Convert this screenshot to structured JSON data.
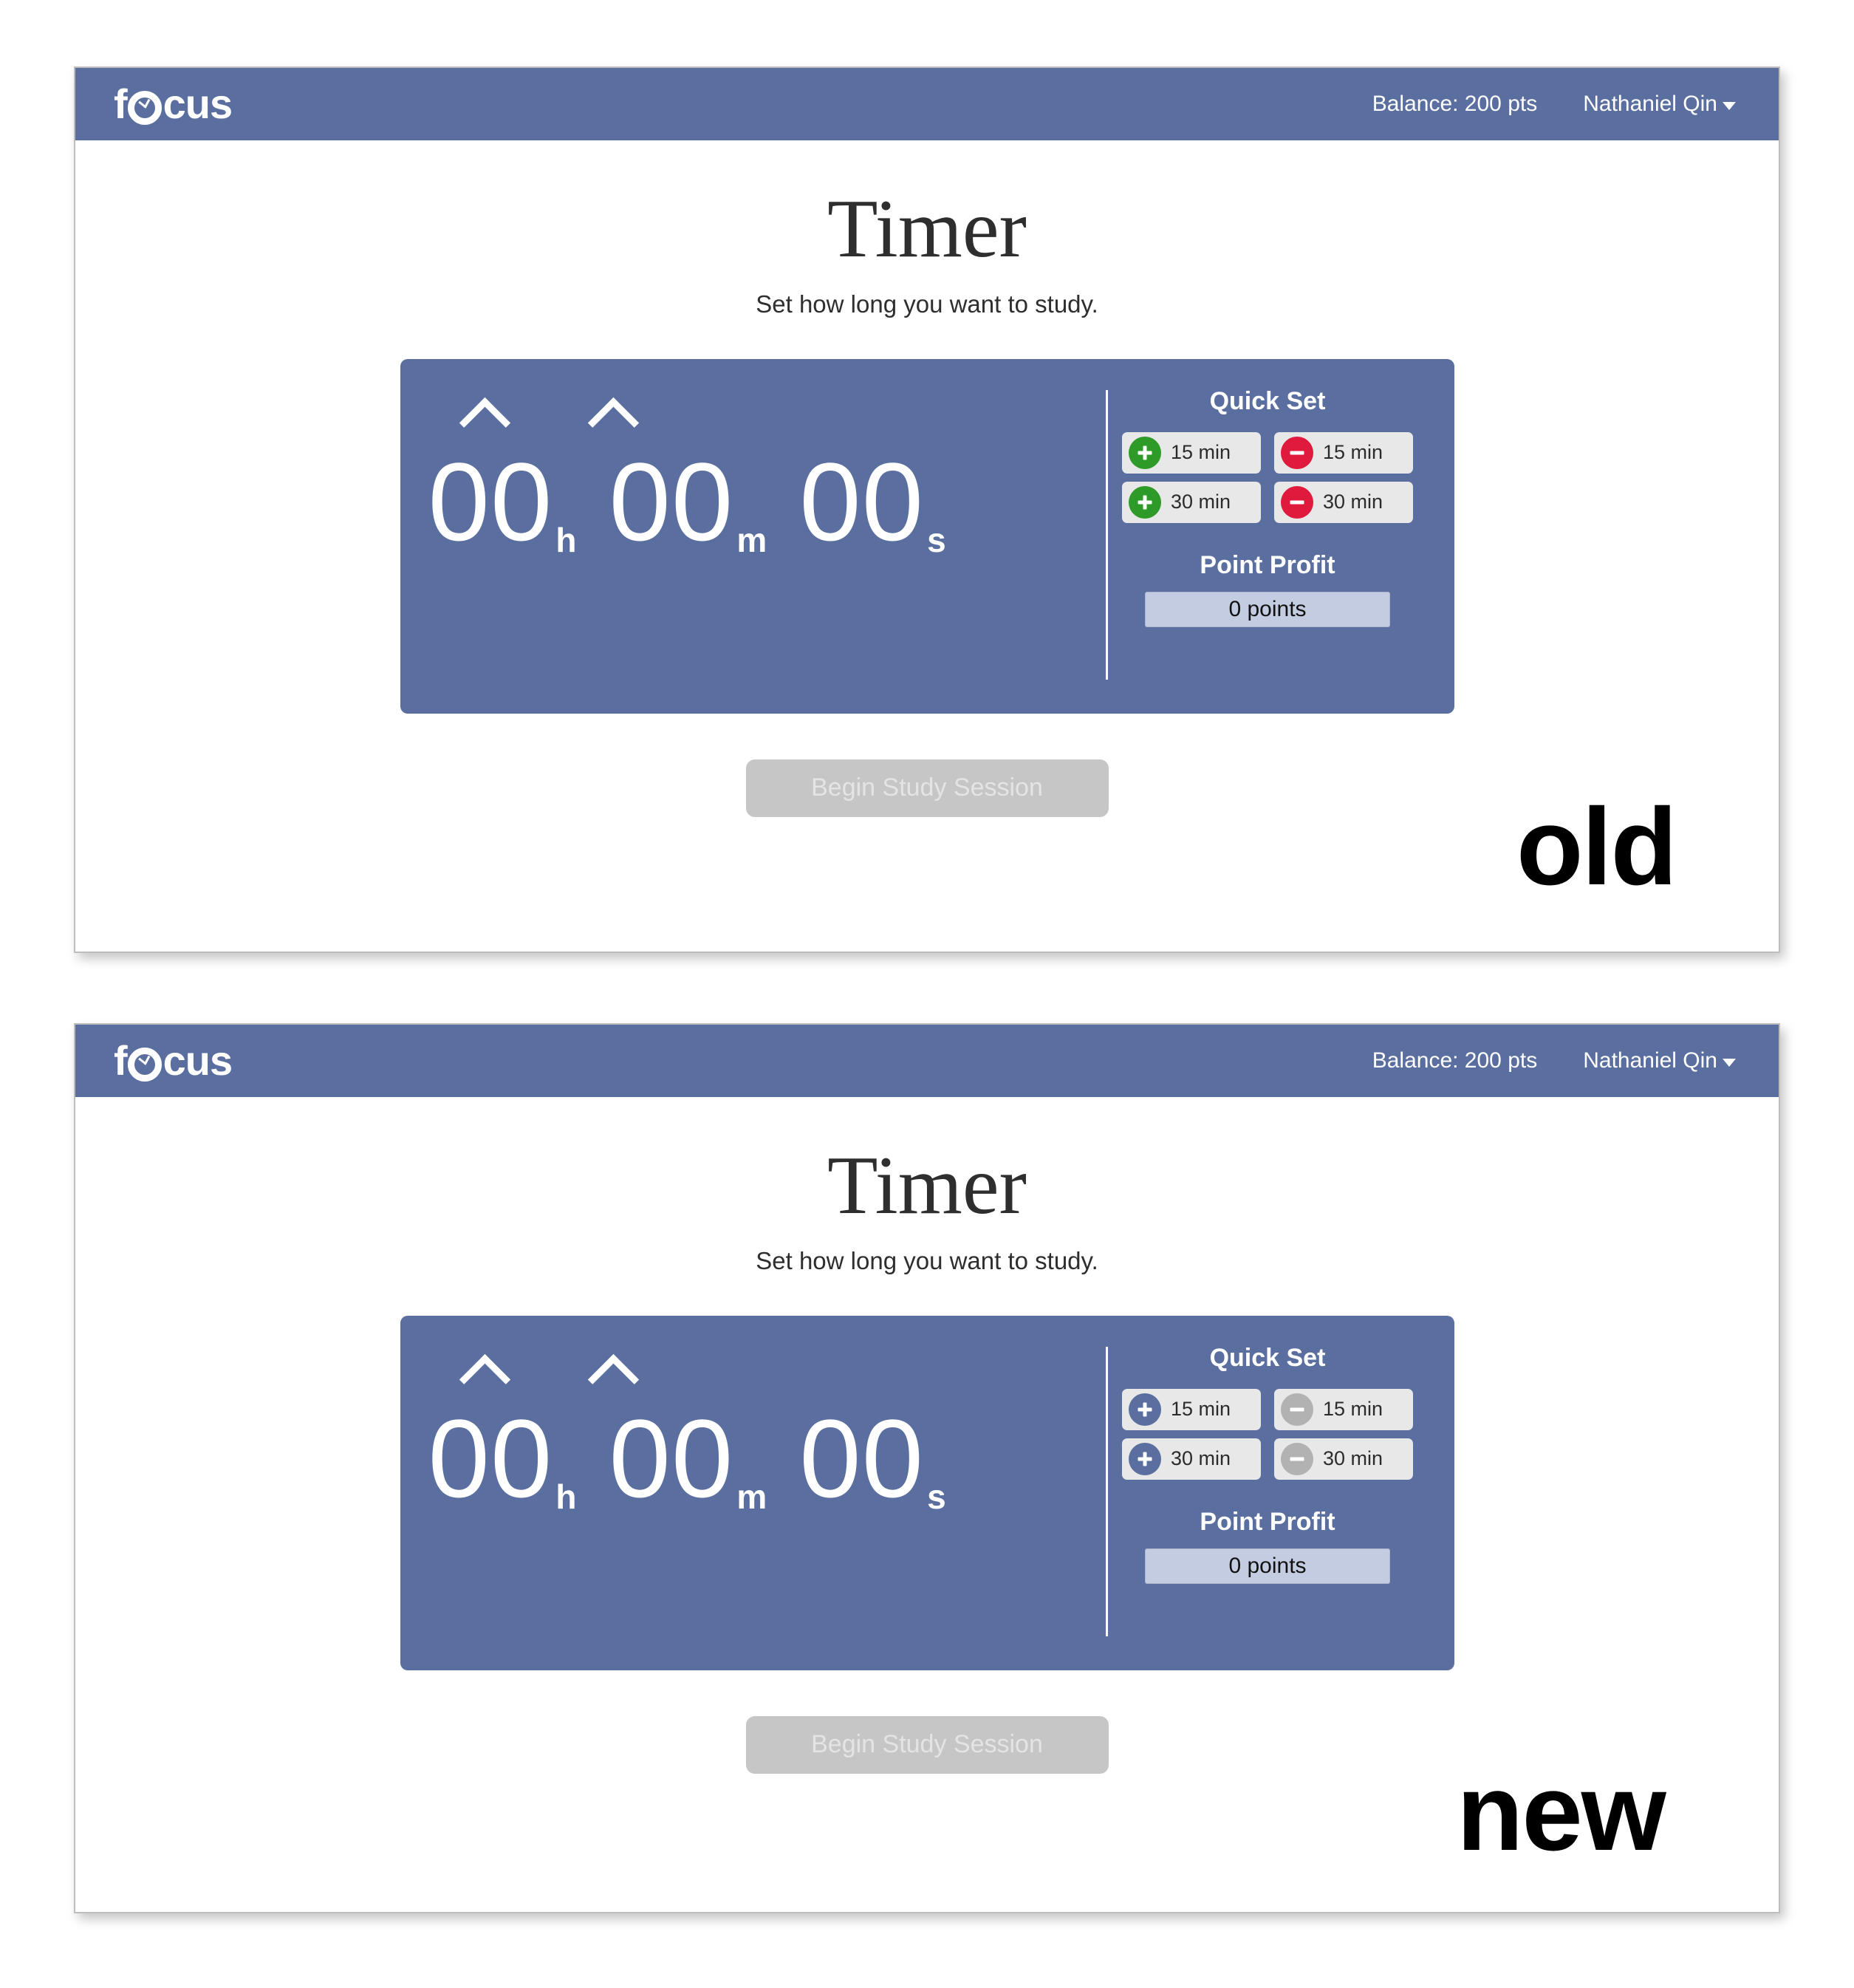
{
  "theme": {
    "brand_blue": "#5a6fa0",
    "plus_green": "#2e9a28",
    "minus_red": "#e01a3c",
    "plus_blue": "#5a6fa0",
    "minus_gray": "#b2b2b2",
    "pill_bg": "#e8e8e8",
    "point_profit_bg": "#c3cce0",
    "disabled_button_bg": "#c6c6c6"
  },
  "navbar": {
    "brand_f": "f",
    "brand_rest": "cus",
    "brand_full": "focus",
    "balance": "Balance: 200 pts",
    "user": "Nathaniel Qin"
  },
  "page": {
    "title": "Timer",
    "subtitle": "Set how long you want to study."
  },
  "timer": {
    "hours": "00",
    "hours_unit": "h",
    "minutes": "00",
    "minutes_unit": "m",
    "seconds": "00",
    "seconds_unit": "s"
  },
  "quick_set": {
    "title": "Quick Set",
    "buttons": [
      {
        "sign": "+",
        "label": "15 min"
      },
      {
        "sign": "-",
        "label": "15 min"
      },
      {
        "sign": "+",
        "label": "30 min"
      },
      {
        "sign": "-",
        "label": "30 min"
      }
    ]
  },
  "point_profit": {
    "title": "Point Profit",
    "value": "0 points"
  },
  "actions": {
    "begin_label": "Begin Study Session"
  },
  "annotations": {
    "old": "old",
    "new": "new"
  }
}
